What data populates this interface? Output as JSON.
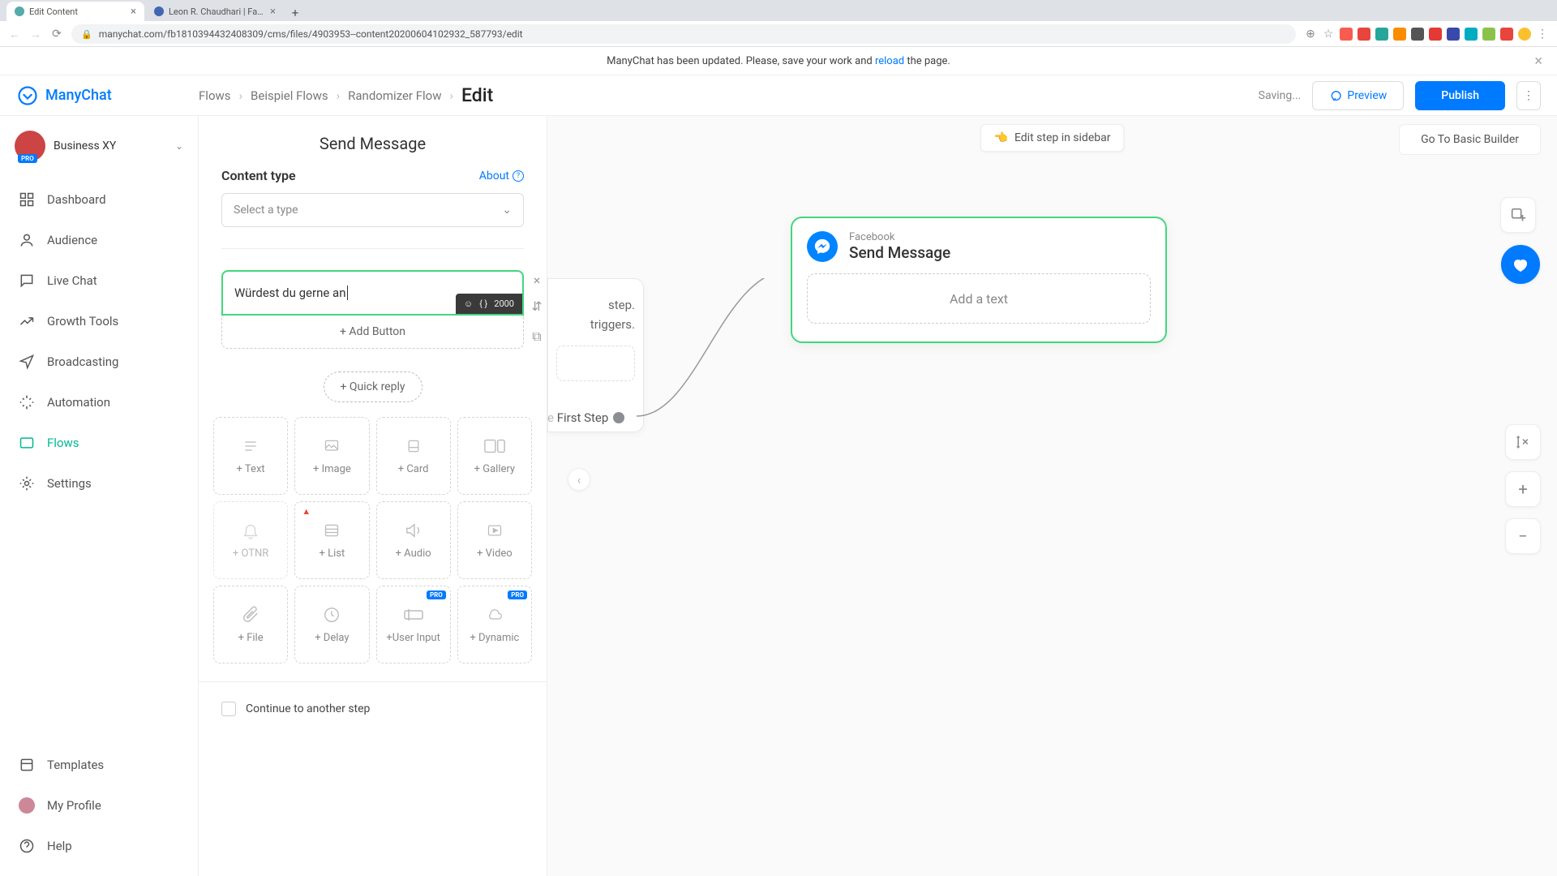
{
  "browser": {
    "tabs": [
      {
        "title": "Edit Content",
        "active": true
      },
      {
        "title": "Leon R. Chaudhari | Facebook",
        "active": false
      }
    ],
    "url": "manychat.com/fb181039443240830​9/cms/files/4903953--content20200604102932_587793/edit"
  },
  "notification": {
    "prefix": "ManyChat has been updated. Please, save your work and ",
    "link_text": "reload",
    "suffix": " the page."
  },
  "brand": "ManyChat",
  "breadcrumbs": [
    "Flows",
    "Beispiel Flows",
    "Randomizer Flow",
    "Edit"
  ],
  "header": {
    "saving": "Saving...",
    "preview": "Preview",
    "publish": "Publish"
  },
  "account": {
    "name": "Business XY",
    "badge": "PRO"
  },
  "nav": {
    "items": [
      "Dashboard",
      "Audience",
      "Live Chat",
      "Growth Tools",
      "Broadcasting",
      "Automation",
      "Flows",
      "Settings"
    ],
    "bottom": [
      "Templates",
      "My Profile",
      "Help"
    ]
  },
  "editor": {
    "title": "Send Message",
    "content_type_label": "Content type",
    "about": "About",
    "select_placeholder": "Select a type",
    "text_value": "Würdest du gerne an ",
    "char_limit": "2000",
    "add_button": "+ Add Button",
    "quick_reply": "+ Quick reply",
    "blocks": [
      {
        "label": "+ Text"
      },
      {
        "label": "+ Image"
      },
      {
        "label": "+ Card"
      },
      {
        "label": "+ Gallery"
      },
      {
        "label": "+ OTNR",
        "disabled": true
      },
      {
        "label": "+ List",
        "warn": true
      },
      {
        "label": "+ Audio"
      },
      {
        "label": "+ Video"
      },
      {
        "label": "+ File"
      },
      {
        "label": "+ Delay"
      },
      {
        "label": "+User Input",
        "pro": true
      },
      {
        "label": "+ Dynamic",
        "pro": true
      }
    ],
    "continue": "Continue to another step",
    "pro_tag": "PRO"
  },
  "canvas": {
    "edit_sidebar": "Edit step in sidebar",
    "go_basic": "Go To Basic Builder",
    "partial_line1": "step.",
    "partial_line2": "triggers.",
    "first_step": "First Step",
    "node": {
      "platform": "Facebook",
      "title": "Send Message",
      "add_text": "Add a text"
    }
  }
}
